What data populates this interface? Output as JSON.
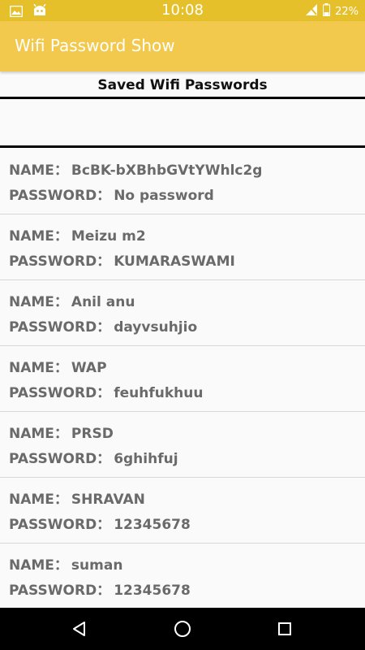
{
  "status_bar": {
    "time": "10:08",
    "battery": "22%",
    "left_icons": [
      "image-icon",
      "android-robot-icon"
    ],
    "right_icons": [
      "signal-off-icon",
      "battery-icon"
    ]
  },
  "app_bar": {
    "title": "Wifi Password Show"
  },
  "header": {
    "title": "Saved Wifi Passwords"
  },
  "labels": {
    "name": "NAME：",
    "password": "PASSWORD："
  },
  "networks": [
    {
      "name": "BcBK-bXBhbGVtYWhlc2g",
      "password": "No password"
    },
    {
      "name": "Meizu m2",
      "password": "KUMARASWAMI"
    },
    {
      "name": "Anil anu",
      "password": "dayvsuhjio"
    },
    {
      "name": "WAP",
      "password": "feuhfukhuu"
    },
    {
      "name": "PRSD",
      "password": "6ghihfuj"
    },
    {
      "name": "SHRAVAN",
      "password": "12345678"
    },
    {
      "name": "suman",
      "password": "12345678"
    }
  ],
  "nav_bar": {
    "buttons": [
      "back-icon",
      "home-icon",
      "recents-icon"
    ]
  },
  "colors": {
    "status_bar": "#e6c02a",
    "app_bar": "#f2c94c",
    "item_text": "#6a6a6a"
  }
}
